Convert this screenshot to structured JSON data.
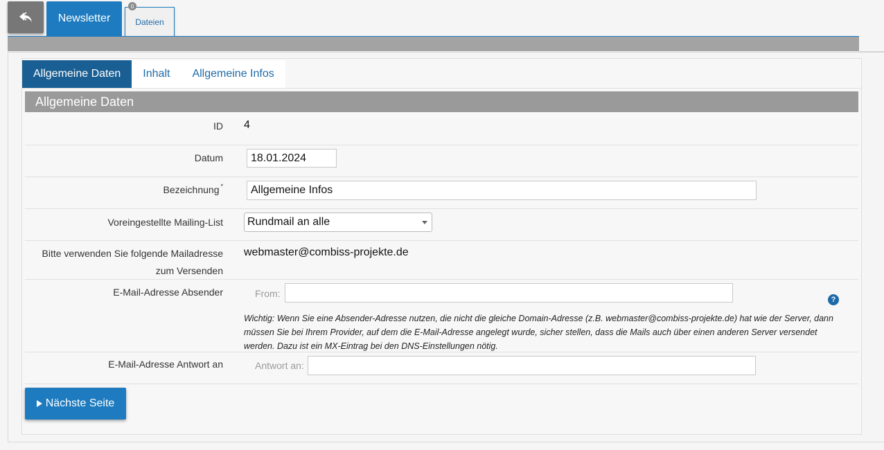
{
  "header": {
    "back_icon": "undo-arrow-icon",
    "tabs": [
      {
        "label": "Newsletter",
        "active": true
      },
      {
        "label": "Dateien",
        "badge": "0"
      }
    ]
  },
  "subtabs": [
    "Allgemeine Daten",
    "Inhalt",
    "Allgemeine Infos"
  ],
  "section_title": "Allgemeine Daten",
  "form": {
    "id": {
      "label": "ID",
      "value": "4"
    },
    "datum": {
      "label": "Datum",
      "value": "18.01.2024"
    },
    "bezeichnung": {
      "label": "Bezeichnung",
      "required_mark": "*",
      "value": "Allgemeine Infos"
    },
    "mailing_list": {
      "label": "Voreingestellte Mailing-List",
      "selected": "Rundmail an alle"
    },
    "mailadresse": {
      "label_line1": "Bitte verwenden Sie folgende Mailadresse",
      "label_line2": "zum Versenden",
      "value": "webmaster@combiss-projekte.de"
    },
    "absender": {
      "label": "E-Mail-Adresse Absender",
      "prefix": "From:",
      "value": "",
      "help": "?",
      "note": "Wichtig: Wenn Sie eine Absender-Adresse nutzen, die nicht die gleiche Domain-Adresse (z.B. webmaster@combiss-projekte.de) hat wie der Server, dann müssen Sie bei Ihrem Provider, auf dem die E-Mail-Adresse angelegt wurde, sicher stellen, dass die Mails auch über einen anderen Server versendet werden. Dazu ist ein MX-Eintrag bei den DNS-Einstellungen nötig."
    },
    "antwort": {
      "label": "E-Mail-Adresse Antwort an",
      "prefix": "Antwort an:",
      "value": ""
    }
  },
  "next_button": "Nächste Seite",
  "colors": {
    "accent": "#1e7bbf",
    "active_subtab": "#1a5f93",
    "section_header": "#9a9a9a"
  }
}
